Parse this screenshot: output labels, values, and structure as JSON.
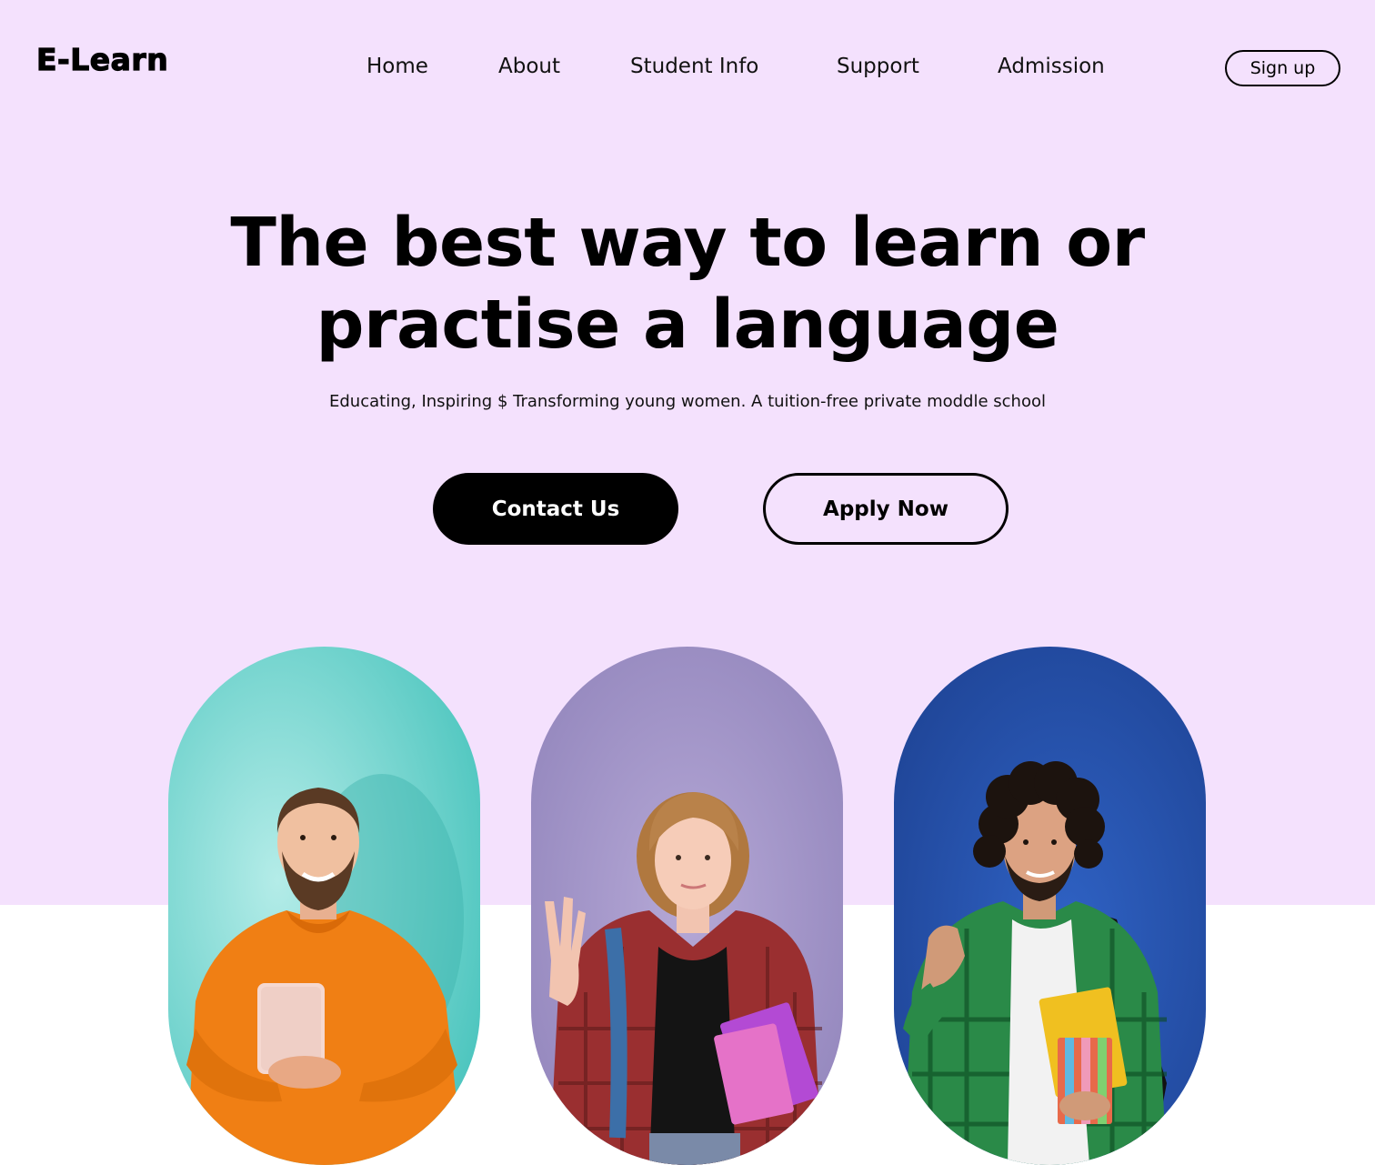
{
  "logo": "E-Learn",
  "nav": {
    "items": [
      "Home",
      "About",
      "Student Info",
      "Support",
      "Admission"
    ],
    "signup_label": "Sign up"
  },
  "hero": {
    "headline_line1": "The best way to learn or",
    "headline_line2": "practise a language",
    "subline": "Educating, Inspiring $ Transforming young women. A tuition-free private moddle school",
    "primary_button": "Contact Us",
    "secondary_button": "Apply Now"
  },
  "colors": {
    "hero_background": "#f4e1fd",
    "card1_background": "#8fdcd8",
    "card2_background": "#9f93c6",
    "card3_background": "#1f4aa6"
  }
}
